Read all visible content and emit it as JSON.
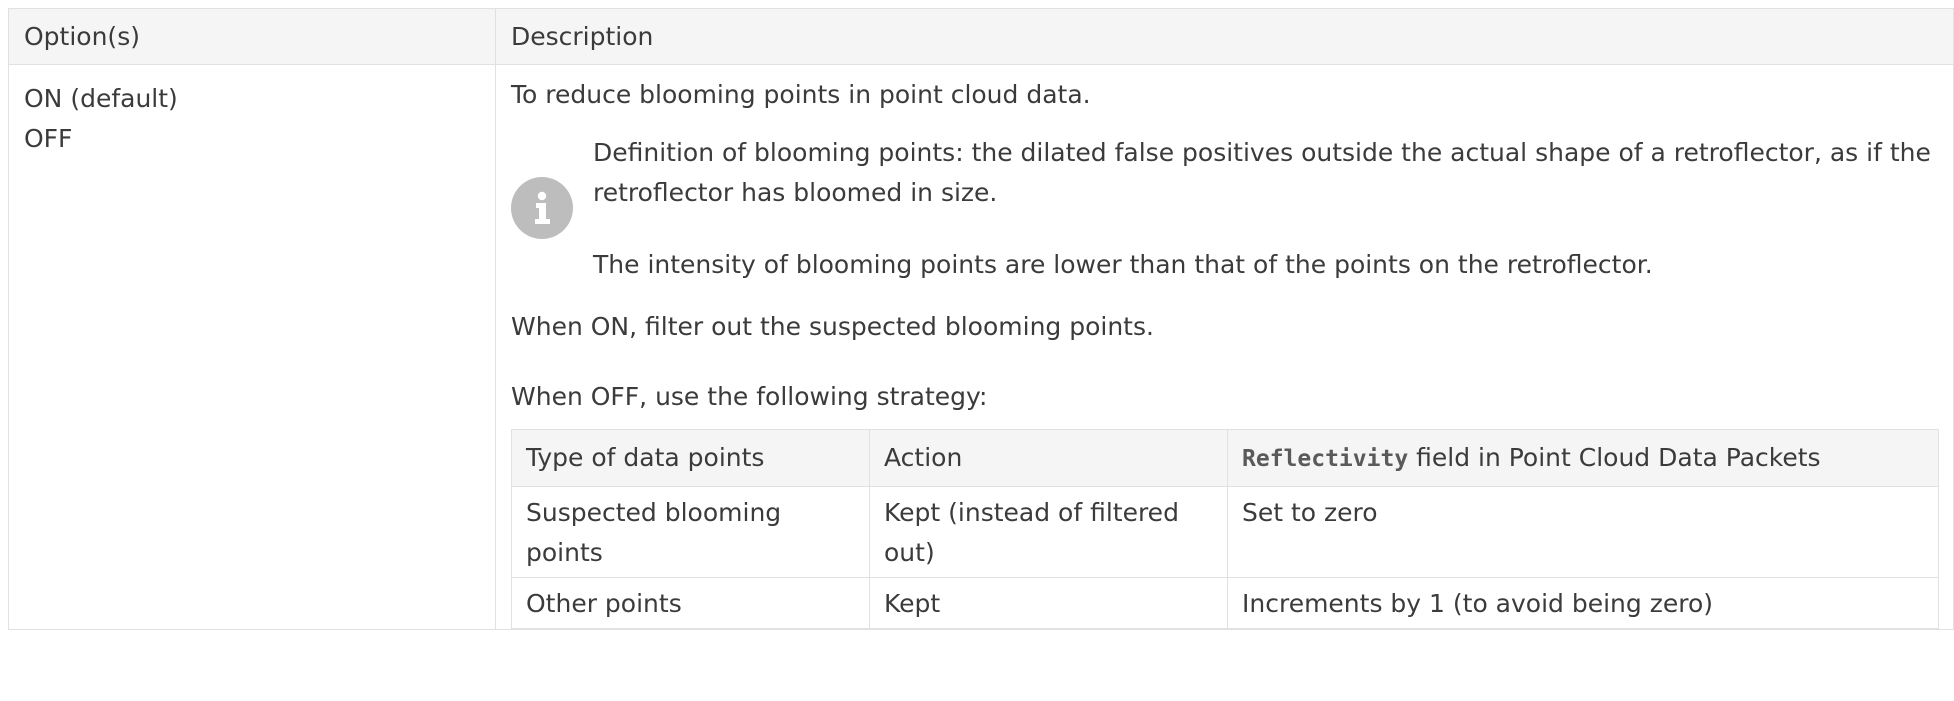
{
  "table": {
    "headers": {
      "options": "Option(s)",
      "description": "Description"
    },
    "row": {
      "options": [
        "ON (default)",
        "OFF"
      ],
      "intro": "To reduce blooming points in point cloud data.",
      "note": {
        "icon": "info-icon",
        "paragraphs": [
          "Definition of blooming points: the dilated false positives outside the actual shape of a retroflector, as if the retroflector has bloomed in size.",
          "The intensity of blooming points are lower than that of the points on the retroflector."
        ]
      },
      "on_text": "When ON, filter out the suspected blooming points.",
      "off_text": "When OFF, use the following strategy:",
      "strategy": {
        "headers": {
          "type": "Type of data points",
          "action": "Action",
          "field_code": "Reflectivity",
          "field_rest": " field in Point Cloud Data Packets"
        },
        "rows": [
          {
            "type": "Suspected blooming points",
            "action": "Kept (instead of filtered out)",
            "field": "Set to zero"
          },
          {
            "type": "Other points",
            "action": "Kept",
            "field": "Increments by 1 (to avoid being zero)"
          }
        ]
      }
    }
  }
}
